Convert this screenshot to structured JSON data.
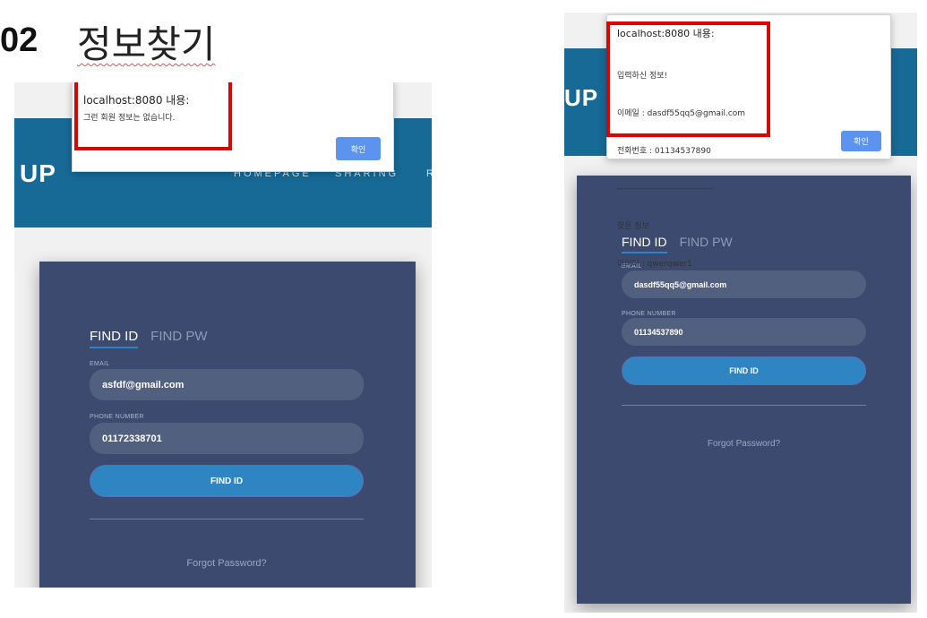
{
  "slide": {
    "number": "02",
    "title": "정보찾기"
  },
  "left": {
    "brand": "UP",
    "nav": [
      "HOMEPAGE",
      "SHARING",
      "R"
    ],
    "dialog": {
      "title": "localhost:8080 내용:",
      "message": "그런 회원 정보는 없습니다.",
      "ok": "확인"
    },
    "form": {
      "tab_active": "FIND ID",
      "tab_inactive": "FIND PW",
      "email_label": "EMAIL",
      "email_value": "asfdf@gmail.com",
      "phone_label": "PHONE NUMBER",
      "phone_value": "01172338701",
      "submit": "FIND ID",
      "forgot": "Forgot Password?"
    }
  },
  "right": {
    "brand": "UP",
    "dialog": {
      "title": "localhost:8080 내용:",
      "lines": [
        "입력하신 정보!",
        "이메일 : dasdf55qq5@gmail.com",
        "전화번호 : 01134537890",
        "---------------------------------",
        "찾은 정보",
        "아이디 : qwerqwer1"
      ],
      "ok": "확인"
    },
    "form": {
      "tab_active": "FIND ID",
      "tab_inactive": "FIND PW",
      "email_label": "EMAIL",
      "email_value": "dasdf55qq5@gmail.com",
      "phone_label": "PHONE NUMBER",
      "phone_value": "01134537890",
      "submit": "FIND ID",
      "forgot": "Forgot Password?"
    }
  }
}
